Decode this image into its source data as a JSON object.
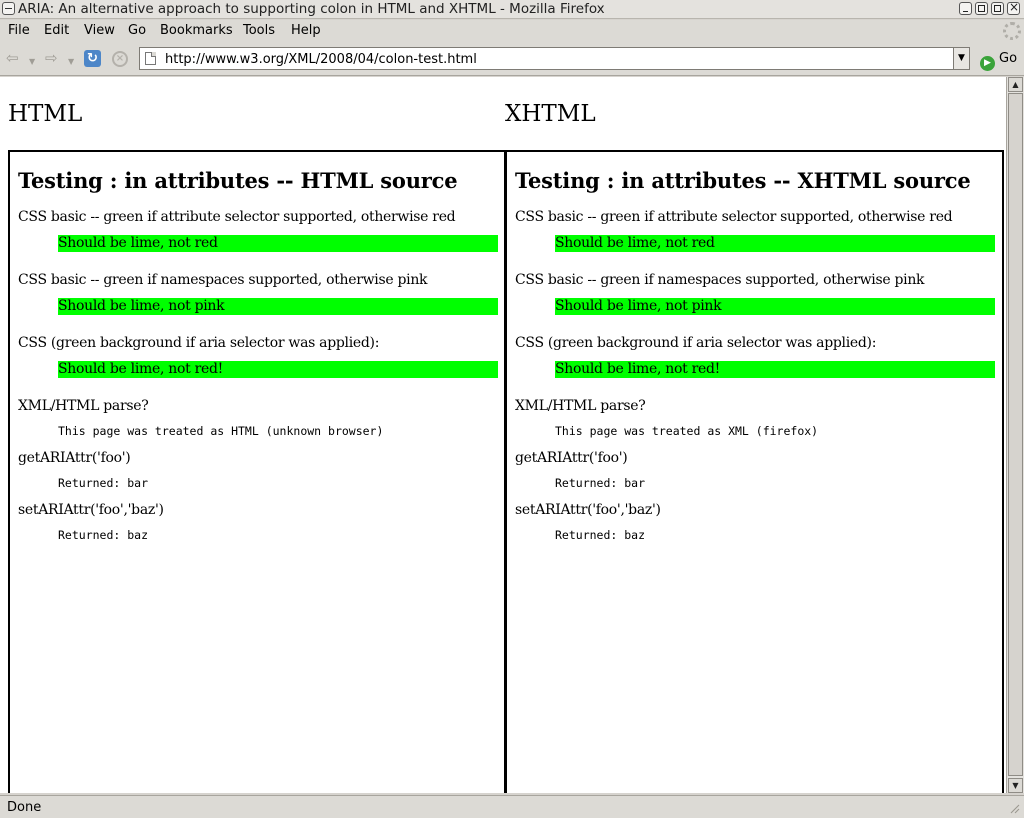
{
  "window": {
    "title": "ARIA: An alternative approach to supporting colon in HTML and XHTML - Mozilla Firefox"
  },
  "menu": {
    "items": [
      "File",
      "Edit",
      "View",
      "Go",
      "Bookmarks",
      "Tools",
      "Help"
    ]
  },
  "navbar": {
    "url": "http://www.w3.org/XML/2008/04/colon-test.html",
    "go_label": "Go"
  },
  "page": {
    "left_heading": "HTML",
    "right_heading": "XHTML",
    "left": {
      "title": "Testing : in attributes -- HTML source",
      "css_basic_label": "CSS basic -- green if attribute selector supported, otherwise red",
      "css_basic_result": "Should be lime, not red",
      "css_ns_label": "CSS basic -- green if namespaces supported, otherwise pink",
      "css_ns_result": "Should be lime, not pink",
      "css_aria_label": "CSS (green background if aria selector was applied):",
      "css_aria_result": "Should be lime, not red!",
      "parse_label": "XML/HTML parse?",
      "parse_result": "This page was treated as HTML (unknown browser)",
      "get_label": "getARIAttr('foo')",
      "get_result": "Returned: bar",
      "set_label": "setARIAttr('foo','baz')",
      "set_result": "Returned: baz"
    },
    "right": {
      "title": "Testing : in attributes -- XHTML source",
      "css_basic_label": "CSS basic -- green if attribute selector supported, otherwise red",
      "css_basic_result": "Should be lime, not red",
      "css_ns_label": "CSS basic -- green if namespaces supported, otherwise pink",
      "css_ns_result": "Should be lime, not pink",
      "css_aria_label": "CSS (green background if aria selector was applied):",
      "css_aria_result": "Should be lime, not red!",
      "parse_label": "XML/HTML parse?",
      "parse_result": "This page was treated as XML (firefox)",
      "get_label": "getARIAttr('foo')",
      "get_result": "Returned: bar",
      "set_label": "setARIAttr('foo','baz')",
      "set_result": "Returned: baz"
    }
  },
  "statusbar": {
    "text": "Done"
  },
  "colors": {
    "lime": "#00ff00"
  }
}
